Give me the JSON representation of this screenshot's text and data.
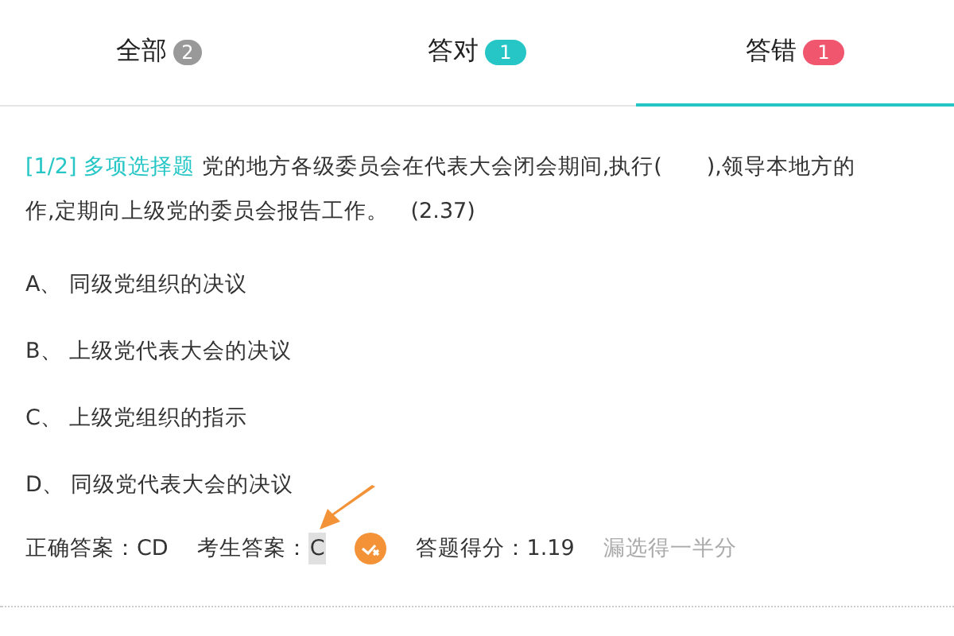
{
  "tabs": [
    {
      "label": "全部",
      "count": "2",
      "color": "#999999",
      "selected": false
    },
    {
      "label": "答对",
      "count": "1",
      "color": "#26c6c6",
      "selected": false
    },
    {
      "label": "答错",
      "count": "1",
      "color": "#f0566e",
      "selected": true
    }
  ],
  "question": {
    "index": "[1/2]",
    "type": "多项选择题",
    "stem_lines": [
      "党的地方各级委员会在代表大会闭会期间,执行(　　),领导本地方的",
      "作,定期向上级党的委员会报告工作。　(2.37)"
    ]
  },
  "options": [
    {
      "letter": "A、",
      "text": "同级党组织的决议"
    },
    {
      "letter": "B、",
      "text": "上级党代表大会的决议"
    },
    {
      "letter": "C、",
      "text": "上级党组织的指示"
    },
    {
      "letter": "D、",
      "text": "同级党代表大会的决议"
    }
  ],
  "result": {
    "correct_label": "正确答案：",
    "correct": "CD",
    "given_label": "考生答案：",
    "given": "C",
    "partially_correct": true,
    "score_label": "答题得分：",
    "score": "1.19",
    "note": "漏选得一半分"
  }
}
